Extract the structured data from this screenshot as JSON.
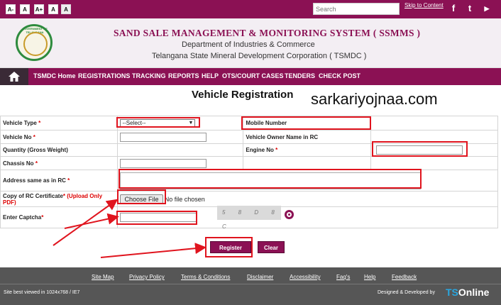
{
  "topbar": {
    "font_buttons": [
      "A-",
      "A",
      "A+",
      "A",
      "A"
    ],
    "search_placeholder": "Search",
    "skip_link": "Skip to Content",
    "social": [
      {
        "icon": "facebook-icon",
        "glyph": "f"
      },
      {
        "icon": "twitter-icon",
        "glyph": "t"
      },
      {
        "icon": "youtube-icon",
        "glyph": "▶"
      }
    ]
  },
  "header": {
    "seal_text": "GOVERNMENT OF TELANGANA",
    "title": "SAND SALE MANAGEMENT & MONITORING SYSTEM ( SSMMS )",
    "subtitle1": "Department of Industries & Commerce",
    "subtitle2": "Telangana State Mineral Development Corporation ( TSMDC )"
  },
  "nav": {
    "items": [
      "TSMDC Home",
      "REGISTRATIONS",
      "TRACKING",
      "REPORTS",
      "HELP",
      "OTS/COURT CASES",
      "TENDERS",
      "CHECK POST"
    ]
  },
  "main": {
    "title": "Vehicle Registration",
    "watermark": "sarkariyojnaa.com"
  },
  "form": {
    "vehicle_type_label": "Vehicle Type",
    "vehicle_type_value": "--Select--",
    "mobile_label": "Mobile Number",
    "vehicle_no_label": "Vehicle No",
    "owner_name_label": "Vehicle Owner Name in RC",
    "quantity_label": "Quantity (Gross Weight)",
    "engine_no_label": "Engine No",
    "chassis_label": "Chassis No",
    "address_label": "Address same as in RC",
    "rc_label": "Copy of RC Certificate",
    "rc_hint": "(Upload Only PDF)",
    "choose_file": "Choose File",
    "no_file": "No file chosen",
    "captcha_label": "Enter Captcha",
    "captcha_text": "5 8 D 8 C",
    "required_mark": "*"
  },
  "buttons": {
    "register": "Register",
    "clear": "Clear"
  },
  "footer": {
    "links": [
      "Site Map",
      "Privacy Policy",
      "Terms & Conditions",
      "Disclaimer",
      "Accessibility",
      "Faq's",
      "Help",
      "Feedback"
    ],
    "note": "Site best viewed in 1024x768 / IE7",
    "designed": "Designed & Developed by",
    "brand_ts": "TS",
    "brand_online": "Online"
  },
  "colors": {
    "brand": "#8b1154",
    "annotation": "#e0141e",
    "footer": "#565656"
  }
}
